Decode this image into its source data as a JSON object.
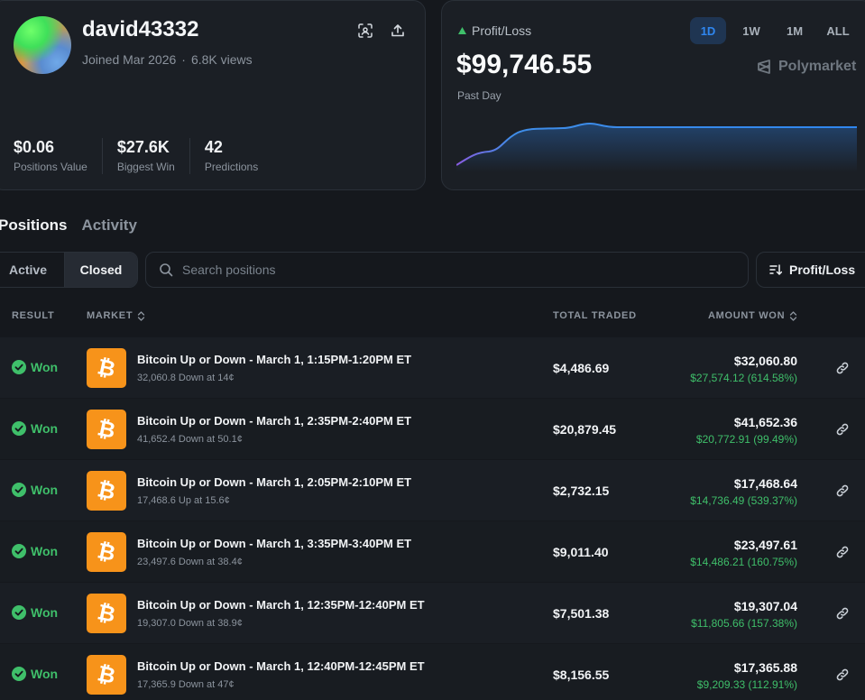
{
  "profile": {
    "username": "david43332",
    "joined": "Joined Mar 2026",
    "views": "6.8K views",
    "stats": [
      {
        "value": "$0.06",
        "label": "Positions Value"
      },
      {
        "value": "$27.6K",
        "label": "Biggest Win"
      },
      {
        "value": "42",
        "label": "Predictions"
      }
    ]
  },
  "pnl": {
    "label": "Profit/Loss",
    "value": "$99,746.55",
    "sub": "Past Day",
    "ranges": [
      "1D",
      "1W",
      "1M",
      "ALL"
    ],
    "active_range": "1D",
    "brand": "Polymarket"
  },
  "tabs": {
    "positions": "Positions",
    "activity": "Activity"
  },
  "filter": {
    "active": "Active",
    "closed": "Closed"
  },
  "search": {
    "placeholder": "Search positions"
  },
  "sort": {
    "label": "Profit/Loss"
  },
  "table": {
    "headers": {
      "result": "RESULT",
      "market": "MARKET",
      "traded": "TOTAL TRADED",
      "won": "AMOUNT WON"
    },
    "rows": [
      {
        "result": "Won",
        "title": "Bitcoin Up or Down - March 1, 1:15PM-1:20PM ET",
        "sub": "32,060.8 Down at 14¢",
        "traded": "$4,486.69",
        "won": "$32,060.80",
        "gain": "$27,574.12 (614.58%)"
      },
      {
        "result": "Won",
        "title": "Bitcoin Up or Down - March 1, 2:35PM-2:40PM ET",
        "sub": "41,652.4 Down at 50.1¢",
        "traded": "$20,879.45",
        "won": "$41,652.36",
        "gain": "$20,772.91 (99.49%)"
      },
      {
        "result": "Won",
        "title": "Bitcoin Up or Down - March 1, 2:05PM-2:10PM ET",
        "sub": "17,468.6 Up at 15.6¢",
        "traded": "$2,732.15",
        "won": "$17,468.64",
        "gain": "$14,736.49 (539.37%)"
      },
      {
        "result": "Won",
        "title": "Bitcoin Up or Down - March 1, 3:35PM-3:40PM ET",
        "sub": "23,497.6 Down at 38.4¢",
        "traded": "$9,011.40",
        "won": "$23,497.61",
        "gain": "$14,486.21 (160.75%)"
      },
      {
        "result": "Won",
        "title": "Bitcoin Up or Down - March 1, 12:35PM-12:40PM ET",
        "sub": "19,307.0 Down at 38.9¢",
        "traded": "$7,501.38",
        "won": "$19,307.04",
        "gain": "$11,805.66 (157.38%)"
      },
      {
        "result": "Won",
        "title": "Bitcoin Up or Down - March 1, 12:40PM-12:45PM ET",
        "sub": "17,365.9 Down at 47¢",
        "traded": "$8,156.55",
        "won": "$17,365.88",
        "gain": "$9,209.33 (112.91%)"
      }
    ]
  },
  "colors": {
    "accent": "#2f86ef",
    "positive": "#3fbf6a",
    "bitcoin": "#f7931a",
    "background": "#15181d"
  }
}
